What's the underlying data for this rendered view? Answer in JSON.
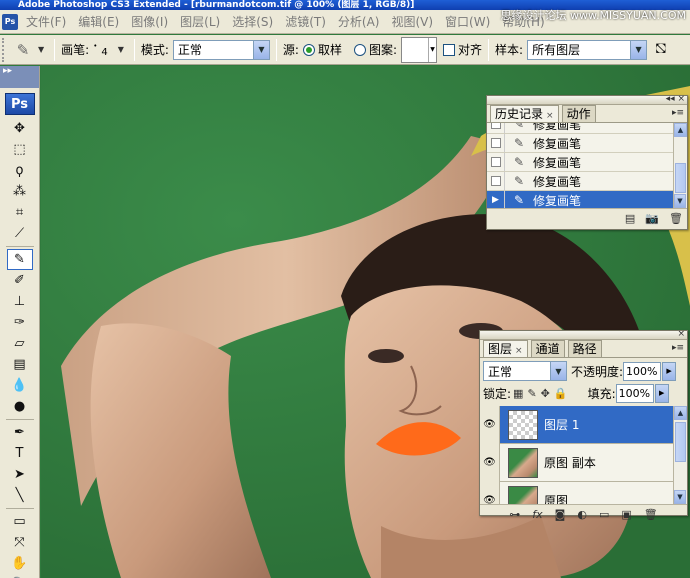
{
  "window": {
    "title": "Adobe Photoshop CS3 Extended - [rburmandotcom.tif @ 100% (图层 1, RGB/8)]",
    "watermark": "思缘设计论坛 www.MISSYUAN.COM"
  },
  "app_icon": "Ps",
  "menu": {
    "items": [
      "文件(F)",
      "编辑(E)",
      "图像(I)",
      "图层(L)",
      "选择(S)",
      "滤镜(T)",
      "分析(A)",
      "视图(V)",
      "窗口(W)",
      "帮助(H)"
    ]
  },
  "options_bar": {
    "tool_icon": "healing-brush-icon",
    "brush_label": "画笔:",
    "brush_size": "4",
    "mode_label": "模式:",
    "mode_value": "正常",
    "source_label": "源:",
    "sampled_label": "取样",
    "pattern_label": "图案:",
    "aligned_label": "对齐",
    "sample_label": "样本:",
    "sample_value": "所有图层"
  },
  "toolbox": {
    "logo": "Ps",
    "tools": [
      {
        "name": "move-tool",
        "glyph": "✥"
      },
      {
        "name": "marquee-tool",
        "glyph": "⬚"
      },
      {
        "name": "lasso-tool",
        "glyph": "ϙ"
      },
      {
        "name": "magic-wand-tool",
        "glyph": "⁂"
      },
      {
        "name": "crop-tool",
        "glyph": "⌗"
      },
      {
        "name": "slice-tool",
        "glyph": "⟋"
      },
      {
        "name": "healing-brush-tool",
        "glyph": "✎"
      },
      {
        "name": "brush-tool",
        "glyph": "✐"
      },
      {
        "name": "clone-stamp-tool",
        "glyph": "⊥"
      },
      {
        "name": "history-brush-tool",
        "glyph": "✑"
      },
      {
        "name": "eraser-tool",
        "glyph": "▱"
      },
      {
        "name": "gradient-tool",
        "glyph": "▤"
      },
      {
        "name": "blur-tool",
        "glyph": "💧"
      },
      {
        "name": "dodge-tool",
        "glyph": "●"
      },
      {
        "name": "pen-tool",
        "glyph": "✒"
      },
      {
        "name": "type-tool",
        "glyph": "T"
      },
      {
        "name": "path-selection-tool",
        "glyph": "➤"
      },
      {
        "name": "line-tool",
        "glyph": "╲"
      },
      {
        "name": "notes-tool",
        "glyph": "▭"
      },
      {
        "name": "eyedropper-tool",
        "glyph": "⤧"
      },
      {
        "name": "hand-tool",
        "glyph": "✋"
      },
      {
        "name": "zoom-tool",
        "glyph": "🔍"
      }
    ],
    "active_index": 6
  },
  "history_panel": {
    "tabs": [
      "历史记录",
      "动作"
    ],
    "items": [
      {
        "label": "修复画笔",
        "selected": false
      },
      {
        "label": "修复画笔",
        "selected": false
      },
      {
        "label": "修复画笔",
        "selected": false
      },
      {
        "label": "修复画笔",
        "selected": false
      },
      {
        "label": "修复画笔",
        "selected": true
      }
    ]
  },
  "layers_panel": {
    "tabs": [
      "图层",
      "通道",
      "路径"
    ],
    "blend_mode": "正常",
    "opacity_label": "不透明度:",
    "opacity_value": "100%",
    "lock_label": "锁定:",
    "fill_label": "填充:",
    "fill_value": "100%",
    "layers": [
      {
        "name": "图层 1",
        "selected": true,
        "thumb": "transparent"
      },
      {
        "name": "原图 副本",
        "selected": false,
        "thumb": "photo"
      },
      {
        "name": "原图",
        "selected": false,
        "thumb": "photo"
      }
    ],
    "footer_icons": [
      "link-icon",
      "fx-icon",
      "mask-icon",
      "adjustment-icon",
      "group-icon",
      "new-layer-icon",
      "trash-icon"
    ]
  },
  "colors": {
    "canvas_background": "#2f7a3d",
    "selection": "#316ac5",
    "lip": "#ff6a1a"
  }
}
